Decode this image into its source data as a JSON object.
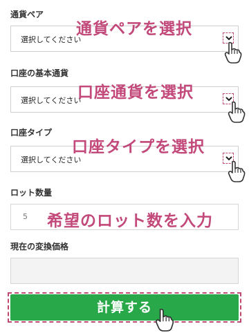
{
  "fields": {
    "pair": {
      "label": "通貨ペア",
      "value": "選択してください",
      "annotation": "通貨ペアを選択"
    },
    "base_currency": {
      "label": "口座の基本通貨",
      "value": "選択してください",
      "annotation": "口座通貨を選択"
    },
    "account_type": {
      "label": "口座タイプ",
      "value": "選択してください",
      "annotation": "口座タイプを選択"
    },
    "lot": {
      "label": "ロット数量",
      "value": "5",
      "annotation": "希望のロット数を入力"
    },
    "rate": {
      "label": "現在の変換価格",
      "value": ""
    }
  },
  "calculate": {
    "label": "計算する"
  },
  "colors": {
    "annotation": "#c2497a",
    "button": "#28a848"
  },
  "icons": [
    "chevron-down-icon",
    "pointer-hand-icon"
  ]
}
